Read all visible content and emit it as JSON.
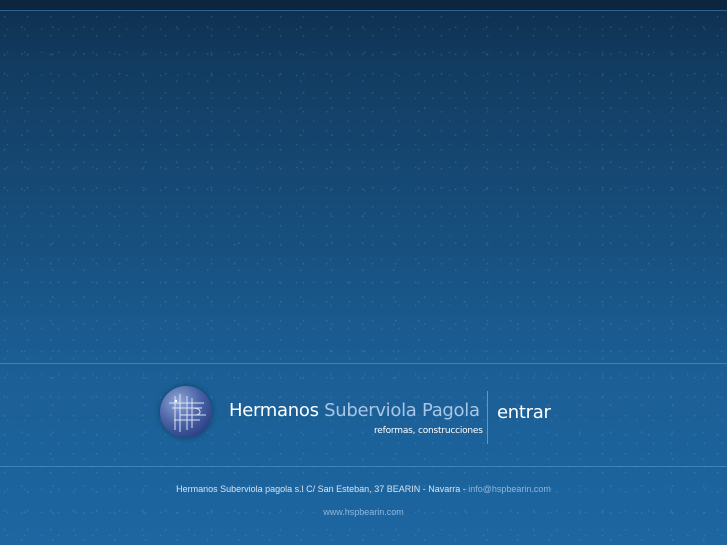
{
  "brand": {
    "name_first": "Hermanos",
    "name_accent": "Suberviola Pagola",
    "tagline": "reformas, construcciones"
  },
  "nav": {
    "enter_label": "entrar"
  },
  "footer": {
    "address": "Hermanos Suberviola pagola s.l C/ San Esteban, 37 BEARIN - Navarra - ",
    "email": "info@hspbearin.com",
    "website": "www.hspbearin.com"
  },
  "colors": {
    "background_top": "#0f2f4e",
    "background_bottom": "#1d66a1",
    "accent_text": "#a9c6e6",
    "link_text": "#8fb6dc"
  },
  "icons": {
    "logo": "hsp-monogram-icon"
  }
}
